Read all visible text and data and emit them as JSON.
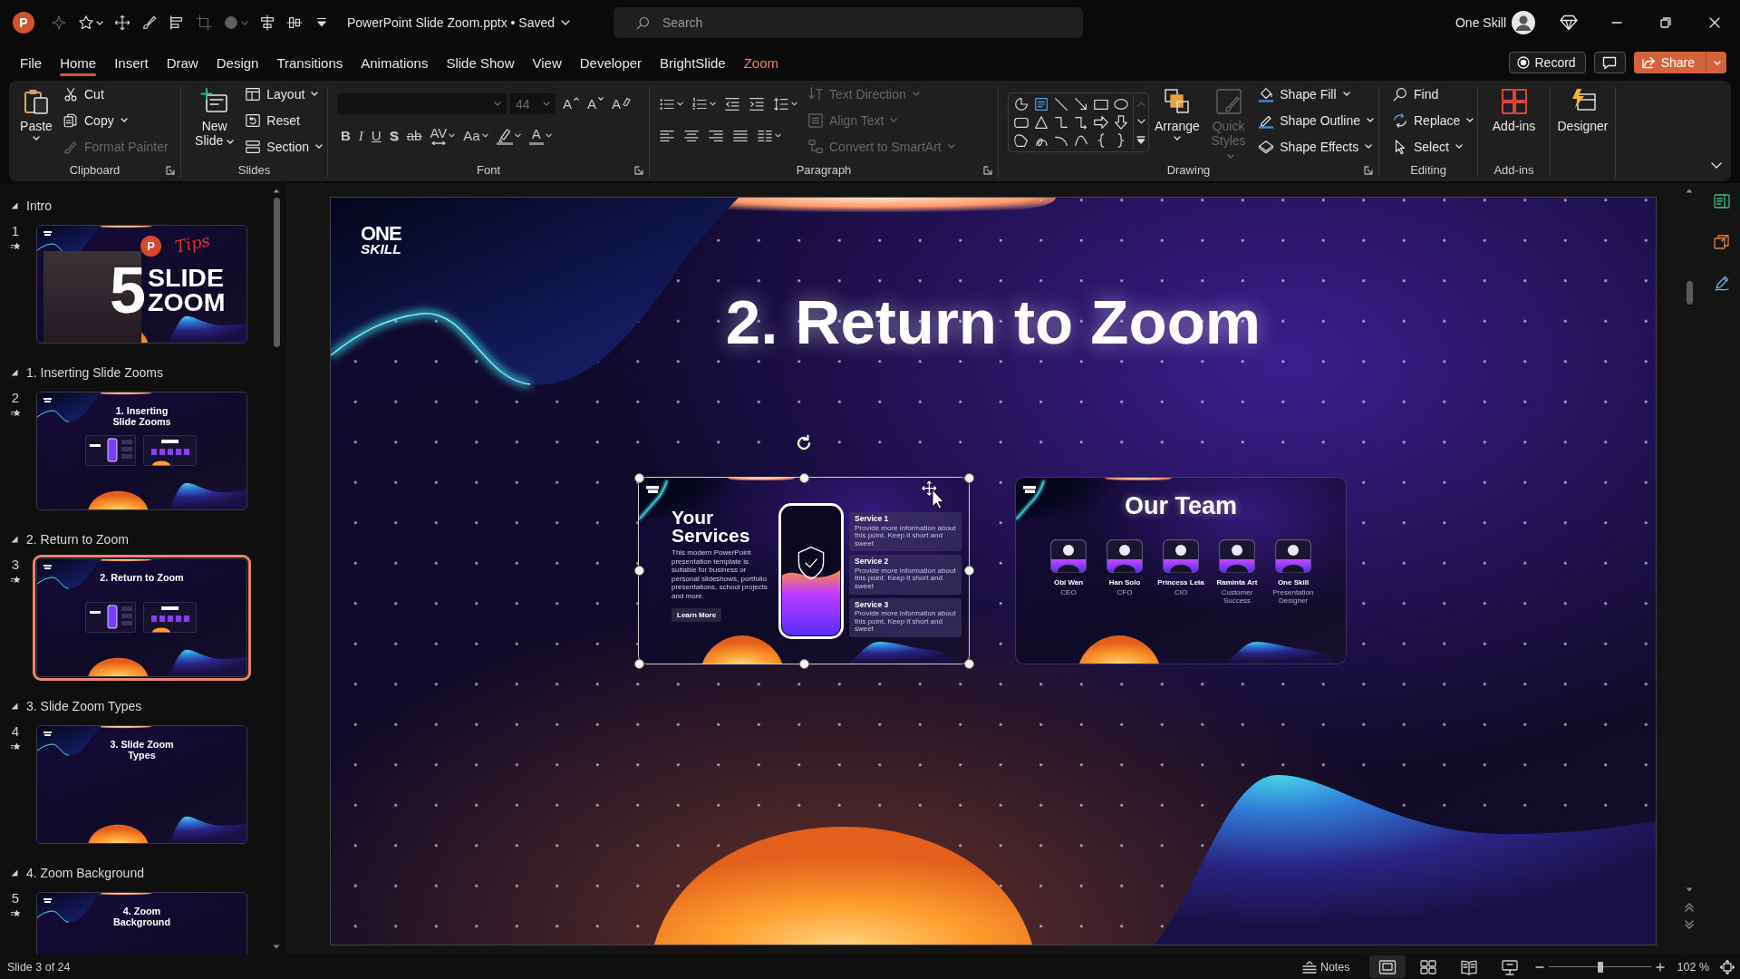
{
  "window": {
    "app_icon": "P",
    "title": "PowerPoint Slide Zoom.pptx • Saved",
    "user": "One Skill"
  },
  "quick_access": [
    {
      "disabled": true,
      "dropdown": false
    },
    {
      "disabled": false,
      "dropdown": true
    },
    {
      "disabled": false,
      "dropdown": false
    },
    {
      "disabled": false,
      "dropdown": false
    },
    {
      "disabled": false,
      "dropdown": false
    },
    {
      "disabled": true,
      "dropdown": false
    },
    {
      "disabled": true,
      "dropdown": true
    },
    {
      "disabled": false,
      "dropdown": false
    },
    {
      "disabled": false,
      "dropdown": false
    },
    {
      "disabled": false,
      "dropdown": false
    }
  ],
  "search": {
    "placeholder": "Search"
  },
  "tabs": [
    {
      "label": "File",
      "selected": false,
      "contextual": false
    },
    {
      "label": "Home",
      "selected": true,
      "contextual": false
    },
    {
      "label": "Insert",
      "selected": false,
      "contextual": false
    },
    {
      "label": "Draw",
      "selected": false,
      "contextual": false
    },
    {
      "label": "Design",
      "selected": false,
      "contextual": false
    },
    {
      "label": "Transitions",
      "selected": false,
      "contextual": false
    },
    {
      "label": "Animations",
      "selected": false,
      "contextual": false
    },
    {
      "label": "Slide Show",
      "selected": false,
      "contextual": false
    },
    {
      "label": "View",
      "selected": false,
      "contextual": false
    },
    {
      "label": "Developer",
      "selected": false,
      "contextual": false
    },
    {
      "label": "BrightSlide",
      "selected": false,
      "contextual": false
    },
    {
      "label": "Zoom",
      "selected": false,
      "contextual": true
    }
  ],
  "tab_actions": {
    "record": "Record",
    "share": "Share"
  },
  "ribbon": {
    "groups": [
      {
        "label": "Clipboard",
        "launcher": true,
        "columns": [
          [
            {
              "kind": "large",
              "label": "Paste",
              "dropdown": true,
              "disabled": false
            }
          ],
          [
            {
              "kind": "small",
              "label": "Cut",
              "dropdown": false,
              "disabled": false
            },
            {
              "kind": "small",
              "label": "Copy",
              "dropdown": true,
              "disabled": false
            },
            {
              "kind": "small",
              "label": "Format Painter",
              "dropdown": false,
              "disabled": true
            }
          ]
        ]
      },
      {
        "label": "Slides",
        "launcher": false,
        "columns": [
          [
            {
              "kind": "large",
              "label": "New Slide",
              "dropdown": true,
              "disabled": false
            }
          ],
          [
            {
              "kind": "small",
              "label": "Layout",
              "dropdown": true,
              "disabled": false
            },
            {
              "kind": "small",
              "label": "Reset",
              "dropdown": false,
              "disabled": false
            },
            {
              "kind": "small",
              "label": "Section",
              "dropdown": true,
              "disabled": false
            }
          ]
        ]
      },
      {
        "label": "Font",
        "launcher": true,
        "columns": [
          [
            {
              "kind": "row",
              "items": [
                {
                  "kind": "field",
                  "dropdown": true,
                  "disabled": true
                },
                {
                  "kind": "field",
                  "value": "44",
                  "dropdown": true,
                  "disabled": true
                },
                {
                  "kind": "tool",
                  "glyph": "A",
                  "dropdown": false,
                  "disabled": false
                },
                {
                  "kind": "tool",
                  "glyph": "A",
                  "dropdown": false,
                  "disabled": false
                },
                {
                  "kind": "tool",
                  "glyph": "A",
                  "dropdown": false,
                  "disabled": false
                }
              ]
            },
            {
              "kind": "row",
              "items": [
                {
                  "kind": "tool",
                  "glyph": "B",
                  "dropdown": false,
                  "disabled": false
                },
                {
                  "kind": "tool",
                  "glyph": "I",
                  "dropdown": false,
                  "disabled": false
                },
                {
                  "kind": "tool",
                  "glyph": "U",
                  "dropdown": false,
                  "disabled": false
                },
                {
                  "kind": "tool",
                  "glyph": "S",
                  "dropdown": false,
                  "disabled": false
                },
                {
                  "kind": "tool",
                  "glyph": "ab",
                  "dropdown": false,
                  "disabled": false
                },
                {
                  "kind": "tool",
                  "glyph": "AV",
                  "dropdown": true,
                  "disabled": false
                },
                {
                  "kind": "tool",
                  "glyph": "Aa",
                  "dropdown": true,
                  "disabled": false
                },
                {
                  "kind": "tool",
                  "dropdown": true,
                  "disabled": false
                },
                {
                  "kind": "tool",
                  "glyph": "A",
                  "dropdown": true,
                  "disabled": false
                }
              ]
            }
          ]
        ]
      },
      {
        "label": "Paragraph",
        "launcher": true,
        "columns": [
          [
            {
              "kind": "row",
              "items": [
                {
                  "kind": "tool",
                  "dropdown": true,
                  "disabled": false
                },
                {
                  "kind": "tool",
                  "dropdown": true,
                  "disabled": false
                },
                {
                  "kind": "tool",
                  "dropdown": false,
                  "disabled": false
                },
                {
                  "kind": "tool",
                  "dropdown": false,
                  "disabled": false
                },
                {
                  "kind": "tool",
                  "dropdown": true,
                  "disabled": false
                }
              ]
            },
            {
              "kind": "row",
              "items": [
                {
                  "kind": "tool",
                  "dropdown": false,
                  "disabled": false
                },
                {
                  "kind": "tool",
                  "dropdown": false,
                  "disabled": false
                },
                {
                  "kind": "tool",
                  "dropdown": false,
                  "disabled": false
                },
                {
                  "kind": "tool",
                  "dropdown": false,
                  "disabled": false
                },
                {
                  "kind": "tool",
                  "dropdown": true,
                  "disabled": false
                }
              ]
            }
          ],
          [
            {
              "kind": "small",
              "label": "Text Direction",
              "dropdown": true,
              "disabled": true
            },
            {
              "kind": "small",
              "label": "Align Text",
              "dropdown": true,
              "disabled": true
            },
            {
              "kind": "small",
              "label": "Convert to SmartArt",
              "dropdown": true,
              "disabled": true
            }
          ]
        ]
      },
      {
        "label": "Drawing",
        "launcher": true,
        "columns": [
          [
            {
              "kind": "gallery"
            }
          ],
          [
            {
              "kind": "large",
              "label": "Arrange",
              "dropdown": true,
              "disabled": false
            }
          ],
          [
            {
              "kind": "large",
              "label": "Quick Styles",
              "dropdown": true,
              "disabled": true
            }
          ],
          [
            {
              "kind": "small",
              "label": "Shape Fill",
              "dropdown": true,
              "disabled": false
            },
            {
              "kind": "small",
              "label": "Shape Outline",
              "dropdown": true,
              "disabled": false
            },
            {
              "kind": "small",
              "label": "Shape Effects",
              "dropdown": true,
              "disabled": false
            }
          ]
        ]
      },
      {
        "label": "Editing",
        "launcher": false,
        "columns": [
          [
            {
              "kind": "small",
              "label": "Find",
              "dropdown": false,
              "disabled": false
            },
            {
              "kind": "small",
              "label": "Replace",
              "dropdown": true,
              "disabled": false
            },
            {
              "kind": "small",
              "label": "Select",
              "dropdown": true,
              "disabled": false
            }
          ]
        ]
      },
      {
        "label": "Add-ins",
        "launcher": false,
        "columns": [
          [
            {
              "kind": "large",
              "label": "Add-ins",
              "dropdown": false,
              "disabled": false
            }
          ]
        ]
      },
      {
        "launcher": false,
        "columns": [
          [
            {
              "kind": "large",
              "label": "Designer",
              "dropdown": false,
              "disabled": false
            }
          ]
        ]
      }
    ]
  },
  "slide_panel": {
    "sections": [
      {
        "title": "Intro",
        "expanded": true,
        "slides": [
          {
            "number": "1",
            "animated": true,
            "selected": false,
            "kind": "cover",
            "badge": "P",
            "tag": "Tips",
            "big": "5",
            "title": "SLIDE\nZOOM"
          }
        ]
      },
      {
        "title": "1. Inserting Slide Zooms",
        "expanded": true,
        "slides": [
          {
            "number": "2",
            "animated": true,
            "selected": false,
            "kind": "zooms",
            "title": "1. Inserting\nSlide Zooms"
          }
        ]
      },
      {
        "title": "2. Return to Zoom",
        "expanded": true,
        "slides": [
          {
            "number": "3",
            "animated": true,
            "selected": true,
            "kind": "zooms",
            "title": "2. Return to Zoom"
          }
        ]
      },
      {
        "title": "3. Slide Zoom Types",
        "expanded": true,
        "slides": [
          {
            "number": "4",
            "animated": true,
            "selected": false,
            "kind": "title",
            "title": "3. Slide Zoom\nTypes"
          }
        ]
      },
      {
        "title": "4. Zoom Background",
        "expanded": true,
        "slides": [
          {
            "number": "5",
            "animated": true,
            "selected": false,
            "kind": "title",
            "title": "4. Zoom\nBackground"
          }
        ]
      }
    ]
  },
  "slide": {
    "logo": [
      "ONE",
      "SKILL"
    ],
    "title": "2. Return to Zoom",
    "zooms": [
      {
        "kind": "services",
        "selected": true,
        "title": "Your Services",
        "text": "This modern PowerPoint presentation template is suitable for business or personal slideshows, portfolio presentations, school projects and more.",
        "button": "Learn More",
        "items": [
          {
            "title": "Service 1",
            "text": "Provide more information about this point. Keep it short and sweet"
          },
          {
            "title": "Service 2",
            "text": "Provide more information about this point. Keep it short and sweet"
          },
          {
            "title": "Service 3",
            "text": "Provide more information about this point. Keep it short and sweet"
          }
        ]
      },
      {
        "kind": "team",
        "selected": false,
        "title": "Our Team",
        "members": [
          {
            "name": "Obi Wan",
            "role": "CEO"
          },
          {
            "name": "Han Solo",
            "role": "CFO"
          },
          {
            "name": "Princess Leia",
            "role": "CIO"
          },
          {
            "name": "Raminta Art",
            "role": "Customer Success"
          },
          {
            "name": "One Skill",
            "role": "Presentation Designer"
          }
        ]
      }
    ]
  },
  "status_bar": {
    "slide_info": "Slide 3 of 24",
    "notes": "Notes",
    "views": [
      {
        "selected": true
      },
      {
        "selected": false
      },
      {
        "selected": false
      },
      {
        "selected": false
      }
    ],
    "zoom": {
      "level": 0.51,
      "reading": "102 %"
    }
  }
}
